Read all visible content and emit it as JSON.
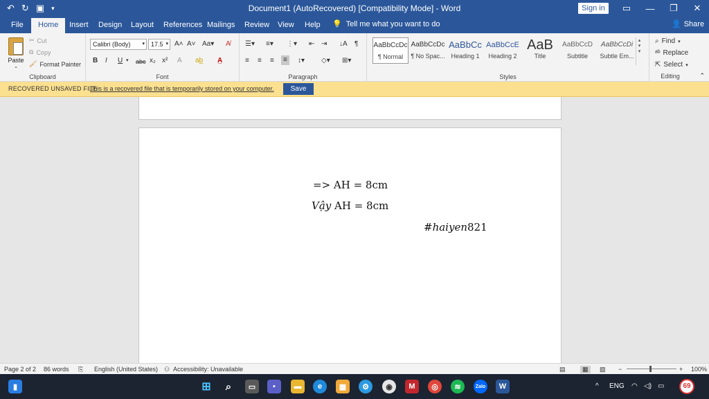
{
  "window": {
    "title": "Document1 (AutoRecovered) [Compatibility Mode] - Word",
    "sign_in": "Sign in"
  },
  "tabs": [
    "File",
    "Home",
    "Insert",
    "Design",
    "Layout",
    "References",
    "Mailings",
    "Review",
    "View",
    "Help"
  ],
  "tell_me": "Tell me what you want to do",
  "share": "Share",
  "clipboard": {
    "paste": "Paste",
    "cut": "Cut",
    "copy": "Copy",
    "format_painter": "Format Painter",
    "label": "Clipboard"
  },
  "font": {
    "name": "Calibri (Body)",
    "size": "17.5",
    "label": "Font"
  },
  "paragraph": {
    "label": "Paragraph"
  },
  "styles": {
    "label": "Styles",
    "items": [
      {
        "preview": "AaBbCcDc",
        "name": "¶ Normal"
      },
      {
        "preview": "AaBbCcDc",
        "name": "¶ No Spac..."
      },
      {
        "preview": "AaBbCc",
        "name": "Heading 1"
      },
      {
        "preview": "AaBbCcE",
        "name": "Heading 2"
      },
      {
        "preview": "AaB",
        "name": "Title"
      },
      {
        "preview": "AaBbCcD",
        "name": "Subtitle"
      },
      {
        "preview": "AaBbCcDi",
        "name": "Subtle Em..."
      }
    ]
  },
  "editing": {
    "find": "Find",
    "replace": "Replace",
    "select": "Select",
    "label": "Editing"
  },
  "recovery": {
    "label": "RECOVERED UNSAVED FILE",
    "message": "This is a recovered file that is temporarily stored on your computer.",
    "save": "Save"
  },
  "document": {
    "line1": "=> AH = 8cm",
    "line2_italic": "Vậy",
    "line2_rest": " AH = 8cm",
    "line3_italic": "#haiyen",
    "line3_rest": "821"
  },
  "status": {
    "page": "Page 2 of 2",
    "words": "86 words",
    "language": "English (United States)",
    "accessibility": "Accessibility: Unavailable",
    "zoom": "100%"
  },
  "taskbar": {
    "lang": "ENG",
    "notification_count": "69"
  }
}
